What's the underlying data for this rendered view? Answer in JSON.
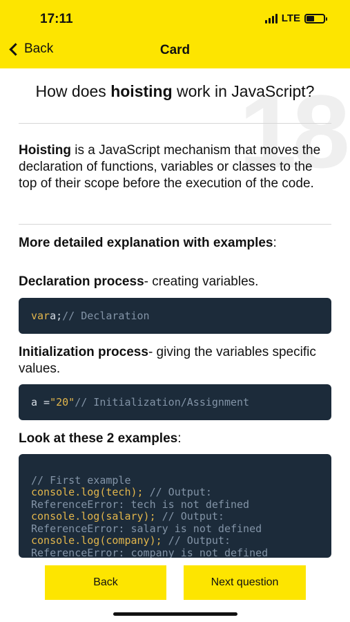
{
  "status_bar": {
    "time": "17:11",
    "network": "LTE",
    "battery_level": 0.45
  },
  "nav": {
    "back_label": "Back",
    "title": "Card"
  },
  "card_number": "18",
  "question": {
    "prefix": "How does ",
    "bold": "hoisting",
    "suffix": " work in JavaScript?"
  },
  "answer": {
    "definition_bold": "Hoisting",
    "definition_rest": " is a JavaScript mechanism that moves the declaration of functions, variables or classes to the top of their scope before the execution of the code.",
    "detail_heading": "More detailed explanation with examples",
    "detail_heading_suffix": ":",
    "declaration_bold": "Declaration process",
    "declaration_rest": "- creating variables.",
    "declaration_code": {
      "kw": "var",
      "rest": " a;",
      "comment": " // Declaration"
    },
    "initialization_bold": "Initialization process",
    "initialization_rest": "- giving the variables specific values.",
    "initialization_code": {
      "lhs": "a = ",
      "str": "\"20\"",
      "comment": " // Initialization/Assignment"
    },
    "examples_heading": "Look at these 2 examples",
    "examples_heading_suffix": ":",
    "example_code": {
      "line1": "// First example",
      "line2_call": "console.log(tech);",
      "line2_comment": " // Output:",
      "line3": "ReferenceError: tech is not defined",
      "line4_call": "console.log(salary);",
      "line4_comment": " // Output:",
      "line5": "ReferenceError: salary is not defined",
      "line6_call": "console.log(company);",
      "line6_comment": " // Output:",
      "line7": "ReferenceError: company is not defined"
    }
  },
  "footer": {
    "back_label": "Back",
    "next_label": "Next question"
  },
  "colors": {
    "accent_yellow": "#fde500",
    "code_bg": "#1c2b3a"
  }
}
